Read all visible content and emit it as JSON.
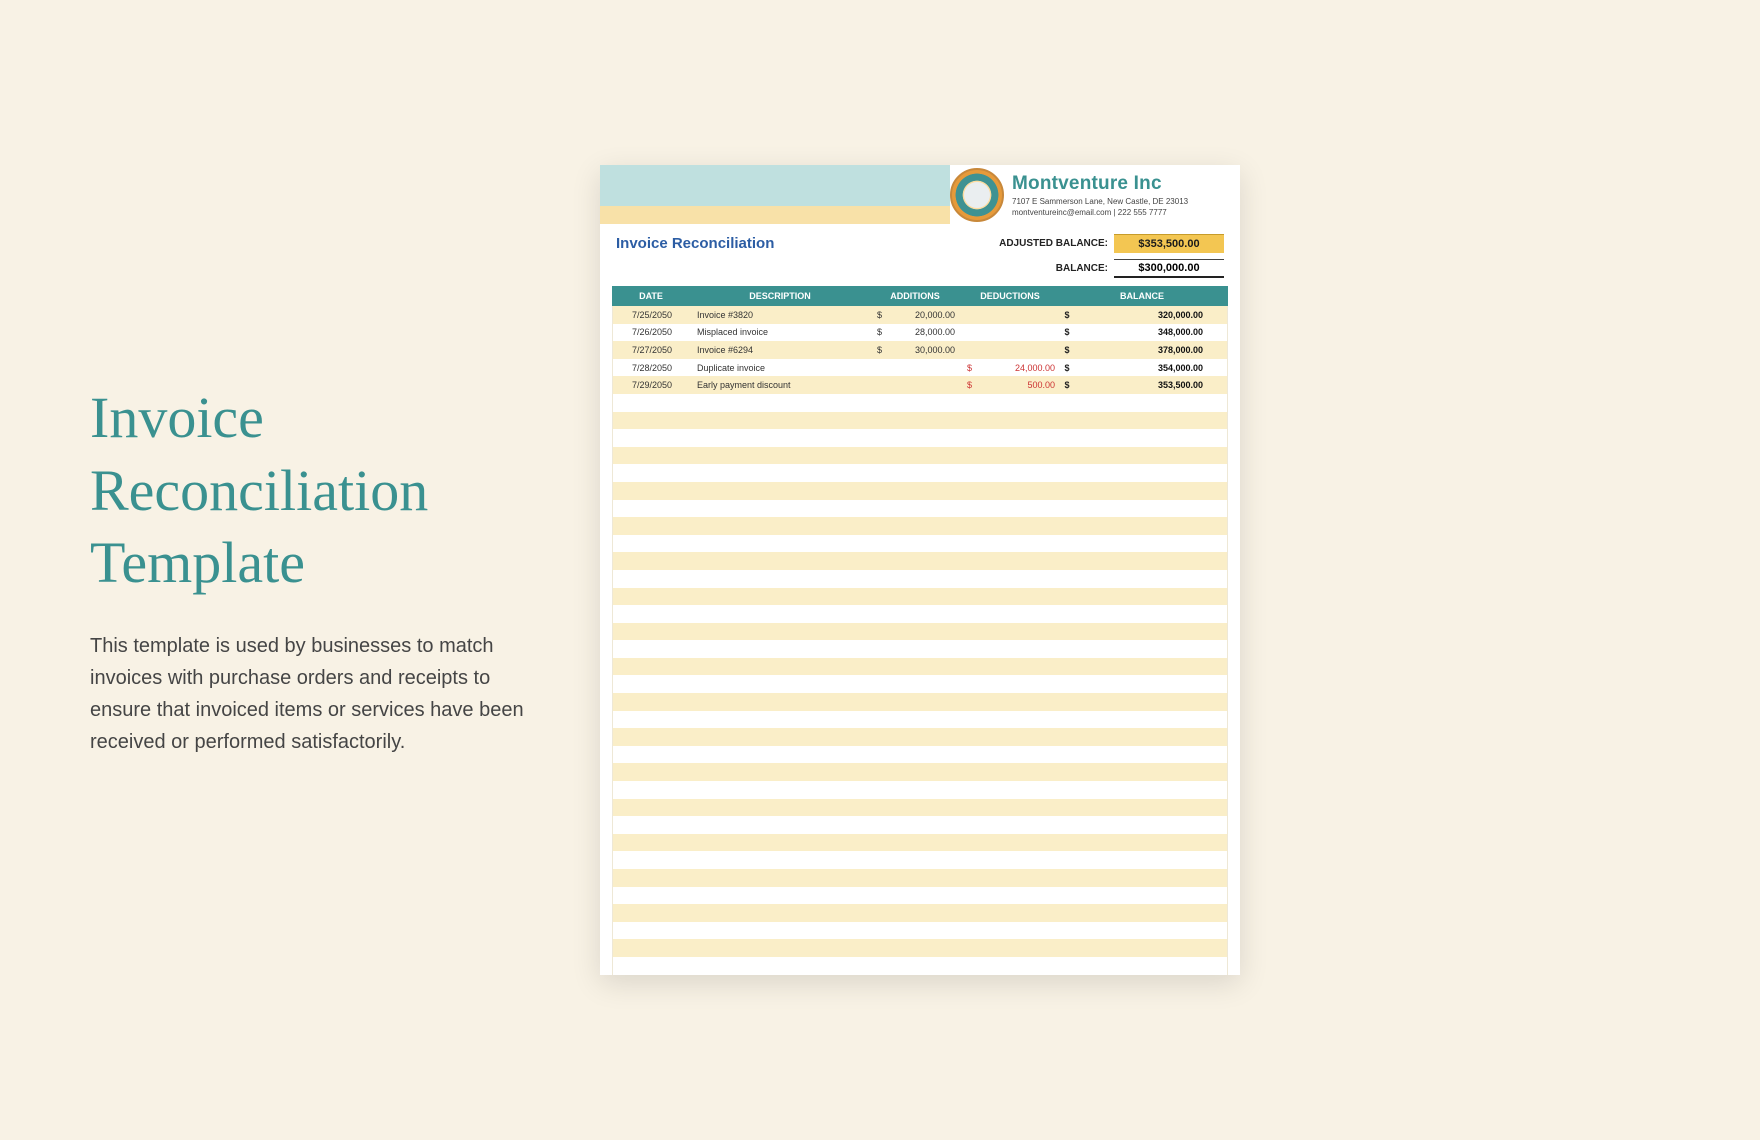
{
  "left": {
    "title": "Invoice Reconciliation Template",
    "description": "This template is used by businesses to match invoices with purchase orders and receipts to ensure that invoiced items or services have been received or performed satisfactorily."
  },
  "company": {
    "name": "Montventure Inc",
    "address": "7107 E Sammerson Lane, New Castle, DE 23013",
    "contact": "montventureinc@email.com | 222 555 7777"
  },
  "sheet": {
    "title": "Invoice Reconciliation",
    "adjusted_label": "ADJUSTED BALANCE:",
    "adjusted_value": "$353,500.00",
    "balance_label": "BALANCE:",
    "balance_value": "$300,000.00"
  },
  "headers": {
    "date": "DATE",
    "description": "DESCRIPTION",
    "additions": "ADDITIONS",
    "deductions": "DEDUCTIONS",
    "balance": "BALANCE"
  },
  "rows": [
    {
      "date": "7/25/2050",
      "desc": "Invoice #3820",
      "add": "20,000.00",
      "ded": "",
      "bal": "320,000.00"
    },
    {
      "date": "7/26/2050",
      "desc": "Misplaced invoice",
      "add": "28,000.00",
      "ded": "",
      "bal": "348,000.00"
    },
    {
      "date": "7/27/2050",
      "desc": "Invoice #6294",
      "add": "30,000.00",
      "ded": "",
      "bal": "378,000.00"
    },
    {
      "date": "7/28/2050",
      "desc": "Duplicate invoice",
      "add": "",
      "ded": "24,000.00",
      "bal": "354,000.00"
    },
    {
      "date": "7/29/2050",
      "desc": "Early payment discount",
      "add": "",
      "ded": "500.00",
      "bal": "353,500.00"
    }
  ],
  "empty_rows": 33
}
